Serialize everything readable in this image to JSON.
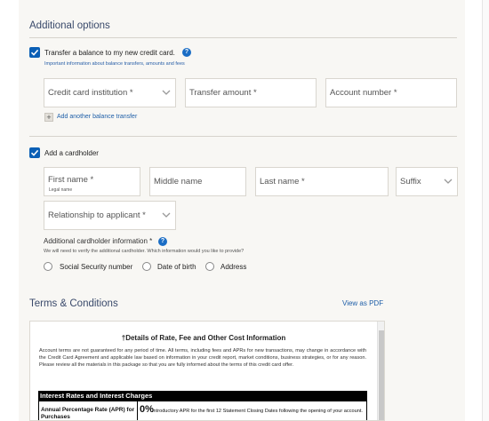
{
  "additional_options": {
    "title": "Additional options",
    "balance_transfer": {
      "checked": true,
      "label": "Transfer a balance to my new credit card.",
      "help_icon": "question-icon",
      "info_link": "Important information about balance transfers, amounts and fees",
      "fields": {
        "institution": "Credit card institution *",
        "amount": "Transfer amount *",
        "account": "Account number *"
      },
      "add_another": "Add another balance transfer"
    },
    "cardholder": {
      "checked": true,
      "label": "Add a cardholder",
      "fields": {
        "first_name": "First name *",
        "first_name_hint": "Legal name",
        "middle_name": "Middle name",
        "last_name": "Last name *",
        "suffix": "Suffix",
        "relationship": "Relationship to applicant *"
      },
      "info_label": "Additional cardholder information *",
      "info_help": "We will need to verify the additional cardholder. Which information would you like to provide?",
      "options": [
        "Social Security number",
        "Date of birth",
        "Address"
      ]
    }
  },
  "terms": {
    "title": "Terms & Conditions",
    "view_pdf": "View as PDF",
    "doc_title": "†Details of Rate, Fee and Other Cost Information",
    "paragraph": "Account terms are not guaranteed for any period of time. All terms, including fees and APRs for new transactions, may change in accordance with the Credit Card Agreement and applicable law based on information in your credit report, market conditions, business strategies, or for any reason. Please review all the materials in this package so that you are fully informed about the terms of this credit card offer.",
    "section_header": "Interest Rates and Interest Charges",
    "row_label": "Annual Percentage Rate (APR) for Purchases",
    "row_value": "0%",
    "row_desc": "Introductory APR for the first 12 Statement Closing Dates following the opening of your account."
  },
  "colors": {
    "accent": "#0b5fb5",
    "panel_bg": "#f8f7f4",
    "heading": "#3a4a6b",
    "link": "#1f5fa8"
  }
}
